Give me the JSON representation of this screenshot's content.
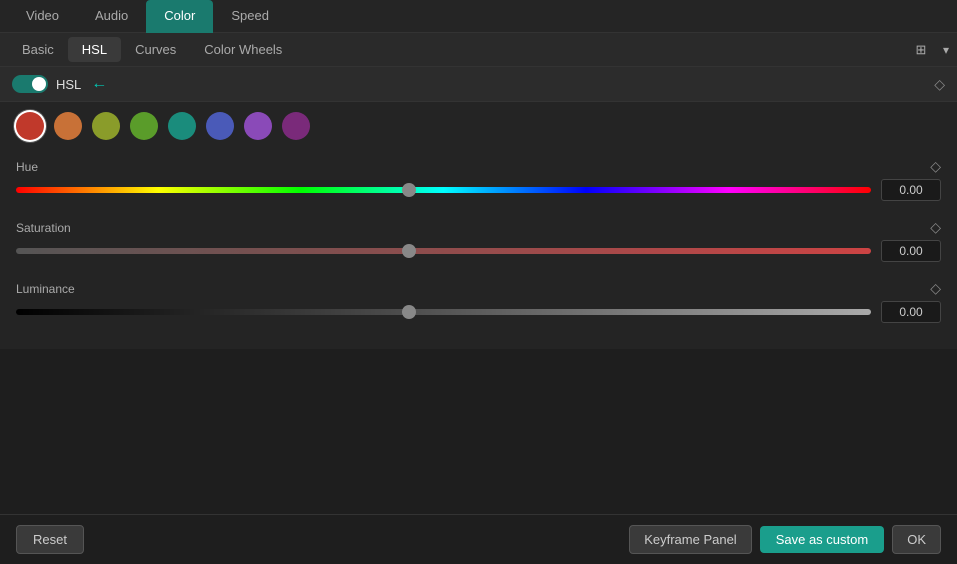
{
  "top_tabs": {
    "tabs": [
      {
        "id": "video",
        "label": "Video",
        "active": false
      },
      {
        "id": "audio",
        "label": "Audio",
        "active": false
      },
      {
        "id": "color",
        "label": "Color",
        "active": true
      },
      {
        "id": "speed",
        "label": "Speed",
        "active": false
      }
    ]
  },
  "sub_tabs": {
    "tabs": [
      {
        "id": "basic",
        "label": "Basic",
        "active": false
      },
      {
        "id": "hsl",
        "label": "HSL",
        "active": true
      },
      {
        "id": "curves",
        "label": "Curves",
        "active": false
      },
      {
        "id": "color_wheels",
        "label": "Color Wheels",
        "active": false
      }
    ]
  },
  "hsl_section": {
    "title": "HSL",
    "enabled": true
  },
  "swatches": [
    {
      "id": "red",
      "color": "#c0392b",
      "selected": true
    },
    {
      "id": "orange",
      "color": "#c87137"
    },
    {
      "id": "yellow_green",
      "color": "#8a9c2a"
    },
    {
      "id": "green",
      "color": "#5a9c2a"
    },
    {
      "id": "teal",
      "color": "#1a8c7c"
    },
    {
      "id": "blue",
      "color": "#4a5ab8"
    },
    {
      "id": "purple",
      "color": "#8a4ab8"
    },
    {
      "id": "magenta",
      "color": "#7a2a7a"
    }
  ],
  "sliders": {
    "hue": {
      "label": "Hue",
      "value": "0.00",
      "thumb_pct": 46
    },
    "saturation": {
      "label": "Saturation",
      "value": "0.00",
      "thumb_pct": 46
    },
    "luminance": {
      "label": "Luminance",
      "value": "0.00",
      "thumb_pct": 46
    }
  },
  "bottom_bar": {
    "reset_label": "Reset",
    "keyframe_label": "Keyframe Panel",
    "save_custom_label": "Save as custom",
    "ok_label": "OK"
  },
  "arrow_char": "←",
  "diamond_char": "◇",
  "split_icon_char": "⊞",
  "chevron_char": "▾"
}
